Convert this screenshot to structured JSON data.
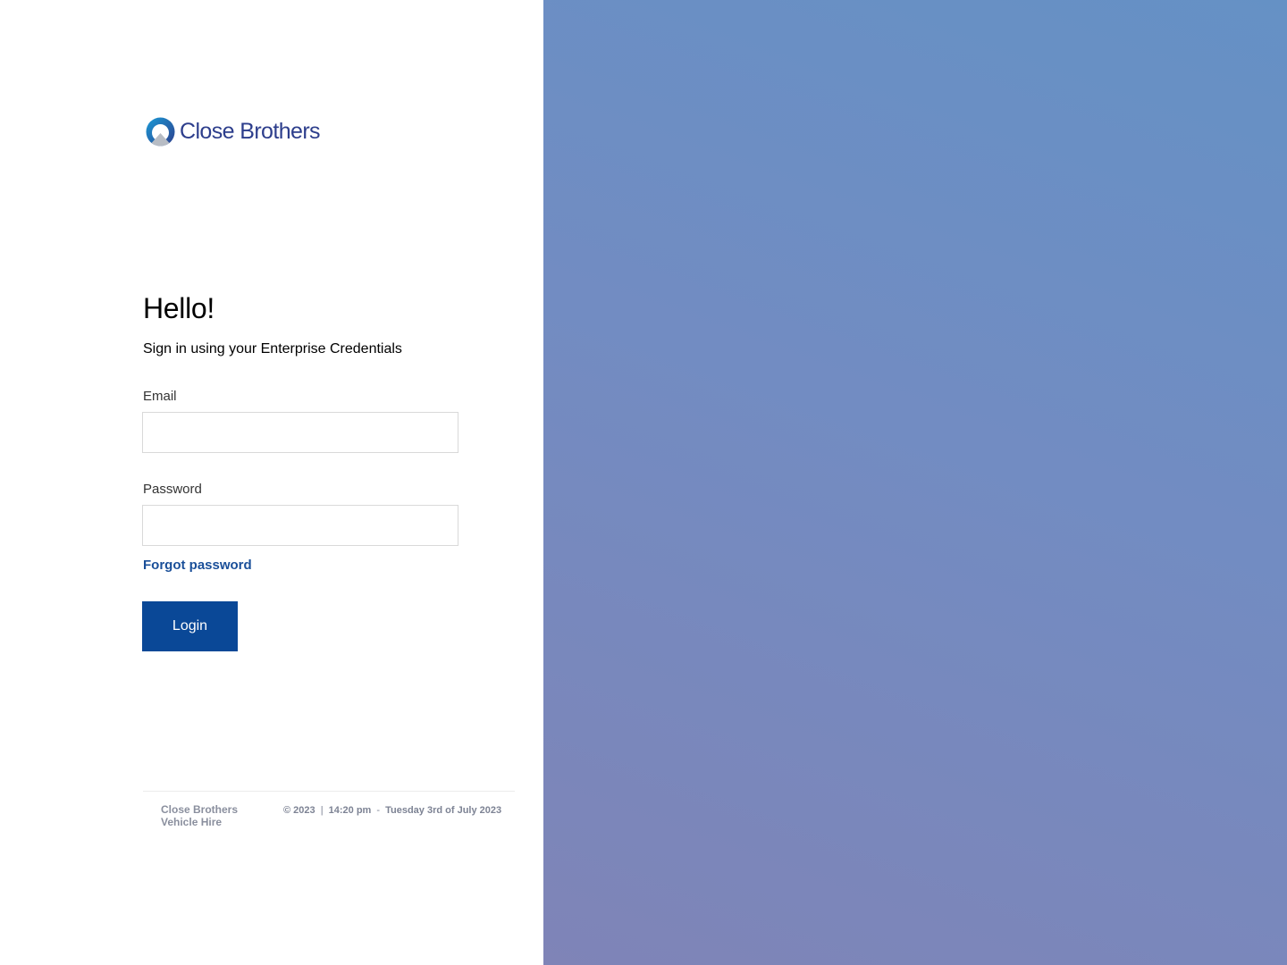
{
  "brand": {
    "name": "Close Brothers",
    "accent_color": "#2d3e8c",
    "logo_icon": "close-brothers-logo-icon"
  },
  "login": {
    "greeting": "Hello!",
    "subtitle": "Sign in using your Enterprise Credentials",
    "email_label": "Email",
    "email_value": "",
    "email_placeholder": "",
    "password_label": "Password",
    "password_value": "",
    "password_placeholder": "",
    "forgot_password": "Forgot password",
    "login_button": "Login",
    "button_color": "#0a4897",
    "link_color": "#1a4f99"
  },
  "footer": {
    "company": "Close Brothers Vehicle Hire",
    "copyright": "© 2023",
    "time": "14:20 pm",
    "date": "Tuesday 3rd of July 2023"
  },
  "background": {
    "gradient_colors": [
      "#6591c5",
      "#728cc2",
      "#7f84b7"
    ]
  }
}
